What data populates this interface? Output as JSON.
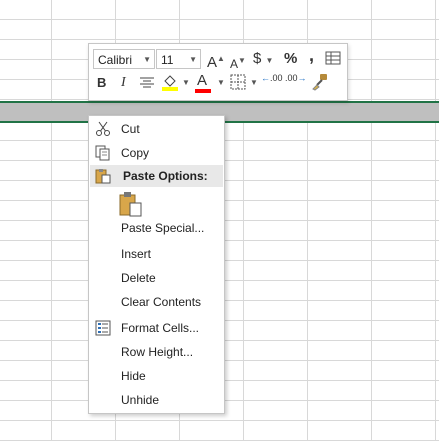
{
  "mini_toolbar": {
    "font_name": "Calibri",
    "font_size": "11",
    "grow_font": "A",
    "shrink_font": "A",
    "currency": "$",
    "percent": "%",
    "comma": ",",
    "bold": "B",
    "italic": "I",
    "font_color": "A",
    "increase_decimal": ".00",
    "decrease_decimal": ".00",
    "fill_color": "#ffff00",
    "font_color_bar": "#ff0000"
  },
  "context_menu": {
    "cut": "Cut",
    "copy": "Copy",
    "paste_options": "Paste Options:",
    "paste_special": "Paste Special...",
    "insert": "Insert",
    "delete": "Delete",
    "clear_contents": "Clear Contents",
    "format_cells": "Format Cells...",
    "row_height": "Row Height...",
    "hide": "Hide",
    "unhide": "Unhide"
  },
  "colors": {
    "selection_border": "#217346",
    "selection_fill": "#bfbfbf",
    "gridline": "#d8d8d8"
  }
}
